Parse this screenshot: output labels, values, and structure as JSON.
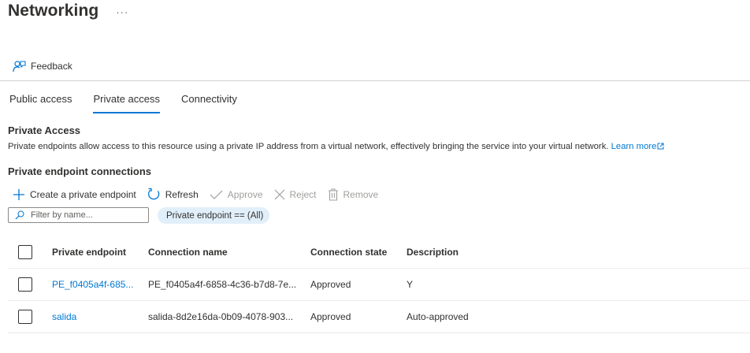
{
  "page": {
    "title": "Networking",
    "more": "···"
  },
  "command_bar": {
    "feedback_label": "Feedback",
    "feedback_icon": "feedback-icon"
  },
  "tabs": [
    {
      "label": "Public access",
      "active": false
    },
    {
      "label": "Private access",
      "active": true
    },
    {
      "label": "Connectivity",
      "active": false
    }
  ],
  "private_access": {
    "title": "Private Access",
    "description": "Private endpoints allow access to this resource using a private IP address from a virtual network, effectively bringing the service into your virtual network.",
    "learn_more": "Learn more"
  },
  "connections": {
    "title": "Private endpoint connections",
    "toolbar": {
      "create": "Create a private endpoint",
      "refresh": "Refresh",
      "approve": "Approve",
      "reject": "Reject",
      "remove": "Remove"
    },
    "filter": {
      "placeholder": "Filter by name...",
      "value": ""
    },
    "pill": "Private endpoint == (All)",
    "columns": [
      "Private endpoint",
      "Connection name",
      "Connection state",
      "Description"
    ],
    "rows": [
      {
        "endpoint": "PE_f0405a4f-685...",
        "connection_name": "PE_f0405a4f-6858-4c36-b7d8-7e...",
        "state": "Approved",
        "description": "Y"
      },
      {
        "endpoint": "salida",
        "connection_name": "salida-8d2e16da-0b09-4078-903...",
        "state": "Approved",
        "description": "Auto-approved"
      }
    ]
  },
  "colors": {
    "accent": "#0078d4",
    "pill_bg": "#e1effa",
    "disabled": "#a19f9d",
    "text": "#323130"
  }
}
